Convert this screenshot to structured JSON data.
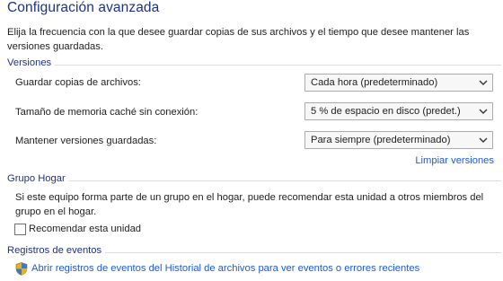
{
  "page_title": "Configuración avanzada",
  "description": "Elija la frecuencia con la que desee guardar copias de sus archivos y el tiempo que desee mantener las versiones guardadas.",
  "sections": {
    "versions": {
      "header": "Versiones",
      "rows": [
        {
          "label": "Guardar copias de archivos:",
          "value": "Cada hora (predeterminado)"
        },
        {
          "label": "Tamaño de memoria caché sin conexión:",
          "value": "5 % de espacio en disco (predet.)"
        },
        {
          "label": "Mantener versiones guardadas:",
          "value": "Para siempre (predeterminado)"
        }
      ],
      "cleanup_link": "Limpiar versiones"
    },
    "homegroup": {
      "header": "Grupo Hogar",
      "text": "Si este equipo forma parte de un grupo en el hogar, puede recomendar esta unidad a otros miembros del grupo en el hogar.",
      "checkbox_label": "Recomendar esta unidad",
      "checkbox_checked": false
    },
    "event_logs": {
      "header": "Registros de eventos",
      "link": "Abrir registros de eventos del Historial de archivos para ver eventos o errores recientes",
      "icon": "uac-shield-icon"
    }
  },
  "colors": {
    "title": "#1e3287",
    "link": "#1c5bd6",
    "divider": "#d8dde6"
  }
}
